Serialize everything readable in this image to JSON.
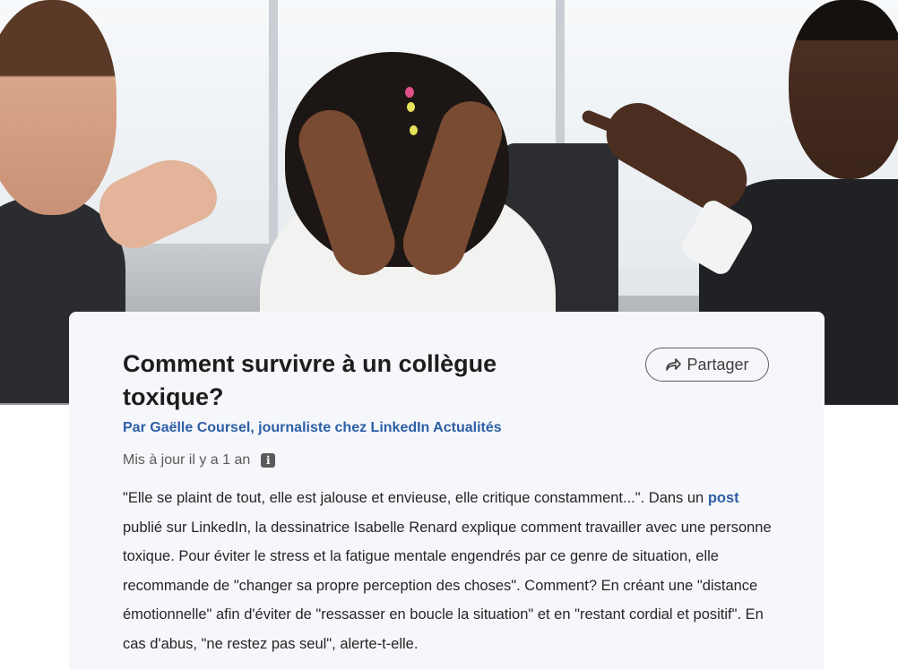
{
  "hero": {
    "image_alt": "photo-three-colleagues-office-conflict"
  },
  "article": {
    "title": "Comment survivre à un collègue toxique?",
    "share_label": "Partager",
    "byline": "Par Gaëlle Coursel, journaliste chez LinkedIn Actualités",
    "updated": "Mis à jour il y a 1 an",
    "body_before_link": "\"Elle se plaint de tout, elle est jalouse et envieuse, elle critique constamment...\". Dans un ",
    "link_text": "post",
    "body_after_link": " publié sur LinkedIn, la dessinatrice Isabelle Renard explique comment travailler avec une personne toxique. Pour éviter le stress et la fatigue mentale engendrés par ce genre de situation, elle recommande de \"changer sa propre perception des choses\". Comment? En créant une \"distance émotionnelle\" afin d'éviter de \"ressasser en boucle la situation\" et en \"restant cordial et positif\". En cas d'abus, \"ne restez pas seul\", alerte-t-elle."
  },
  "icons": {
    "share": "share-arrow-icon",
    "info": "info-icon"
  },
  "colors": {
    "link": "#2d5fa6",
    "card_bg": "#f6f7fb",
    "title": "#1d1d1d"
  }
}
